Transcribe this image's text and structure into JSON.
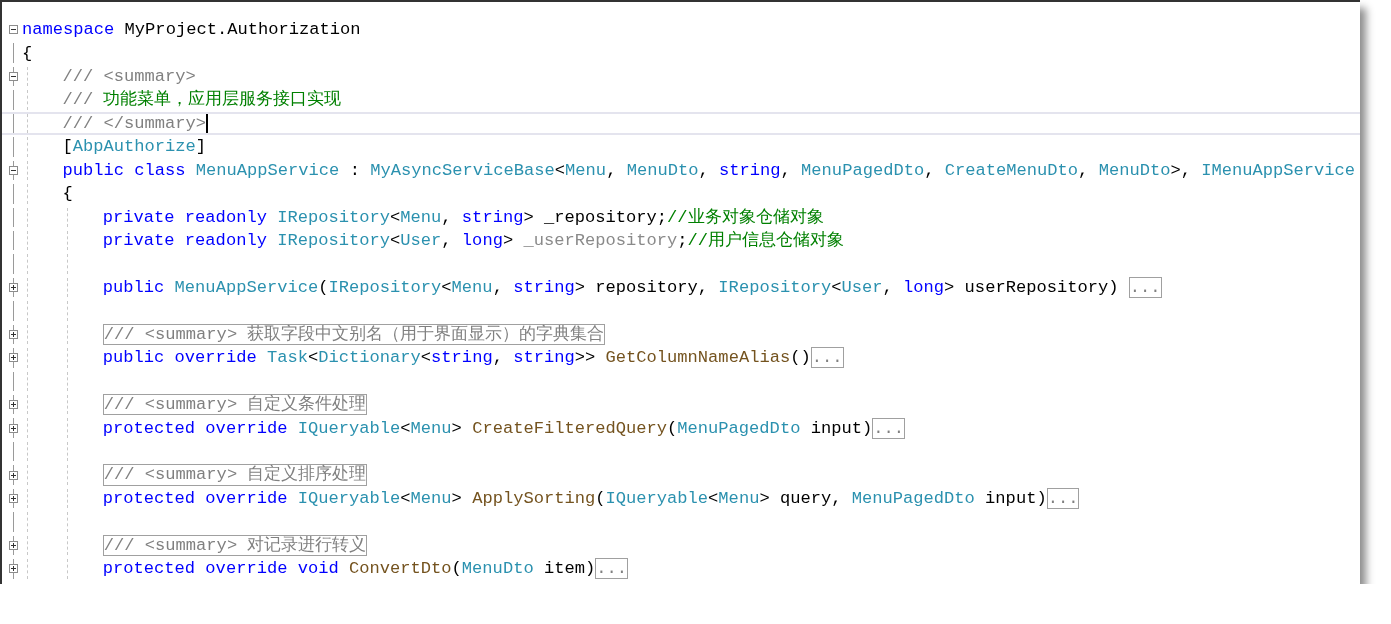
{
  "editor": {
    "lines": [
      {
        "expanded": true,
        "current": false,
        "tokens": [
          {
            "kind": "kw",
            "t": "namespace "
          },
          {
            "kind": "plain",
            "t": "MyProject.Authorization"
          }
        ]
      },
      {
        "current": false,
        "tokens": [
          {
            "kind": "plain",
            "t": "{"
          }
        ],
        "children": [
          {
            "expanded": true,
            "current": false,
            "tokens": [
              {
                "kind": "doc",
                "t": "/// <summary>"
              }
            ]
          },
          {
            "current": false,
            "tokens": [
              {
                "kind": "doc",
                "t": "/// "
              },
              {
                "kind": "comment",
                "t": "功能菜单，应用层服务接口实现"
              }
            ]
          },
          {
            "current": true,
            "tokens": [
              {
                "kind": "doc",
                "t": "/// </summary>"
              }
            ]
          },
          {
            "current": false,
            "tokens": [
              {
                "kind": "plain",
                "t": "["
              },
              {
                "kind": "type",
                "t": "AbpAuthorize"
              },
              {
                "kind": "plain",
                "t": "]"
              }
            ]
          },
          {
            "expanded": true,
            "current": false,
            "tokens": [
              {
                "kind": "kw",
                "t": "public class "
              },
              {
                "kind": "type",
                "t": "MenuAppService"
              },
              {
                "kind": "plain",
                "t": " : "
              },
              {
                "kind": "type",
                "t": "MyAsyncServiceBase"
              },
              {
                "kind": "plain",
                "t": "<"
              },
              {
                "kind": "type",
                "t": "Menu"
              },
              {
                "kind": "plain",
                "t": ", "
              },
              {
                "kind": "type",
                "t": "MenuDto"
              },
              {
                "kind": "plain",
                "t": ", "
              },
              {
                "kind": "kw",
                "t": "string"
              },
              {
                "kind": "plain",
                "t": ", "
              },
              {
                "kind": "type",
                "t": "MenuPagedDto"
              },
              {
                "kind": "plain",
                "t": ", "
              },
              {
                "kind": "type",
                "t": "CreateMenuDto"
              },
              {
                "kind": "plain",
                "t": ", "
              },
              {
                "kind": "type",
                "t": "MenuDto"
              },
              {
                "kind": "plain",
                "t": ">, "
              },
              {
                "kind": "type",
                "t": "IMenuAppService"
              }
            ]
          },
          {
            "current": false,
            "tokens": [
              {
                "kind": "plain",
                "t": "{"
              }
            ],
            "children": [
              {
                "current": false,
                "tokens": [
                  {
                    "kind": "kw",
                    "t": "private readonly "
                  },
                  {
                    "kind": "type",
                    "t": "IRepository"
                  },
                  {
                    "kind": "plain",
                    "t": "<"
                  },
                  {
                    "kind": "type",
                    "t": "Menu"
                  },
                  {
                    "kind": "plain",
                    "t": ", "
                  },
                  {
                    "kind": "kw",
                    "t": "string"
                  },
                  {
                    "kind": "plain",
                    "t": "> _repository;"
                  },
                  {
                    "kind": "comment",
                    "t": "//业务对象仓储对象"
                  }
                ]
              },
              {
                "current": false,
                "tokens": [
                  {
                    "kind": "kw",
                    "t": "private readonly "
                  },
                  {
                    "kind": "type",
                    "t": "IRepository"
                  },
                  {
                    "kind": "plain",
                    "t": "<"
                  },
                  {
                    "kind": "type",
                    "t": "User"
                  },
                  {
                    "kind": "plain",
                    "t": ", "
                  },
                  {
                    "kind": "kw",
                    "t": "long"
                  },
                  {
                    "kind": "plain",
                    "t": "> "
                  },
                  {
                    "kind": "unused",
                    "t": "_userRepository"
                  },
                  {
                    "kind": "plain",
                    "t": ";"
                  },
                  {
                    "kind": "comment",
                    "t": "//用户信息仓储对象"
                  }
                ]
              },
              {
                "current": false
              },
              {
                "expanded": false,
                "current": false,
                "tokens": [
                  {
                    "kind": "kw",
                    "t": "public "
                  },
                  {
                    "kind": "type",
                    "t": "MenuAppService"
                  },
                  {
                    "kind": "plain",
                    "t": "("
                  },
                  {
                    "kind": "type",
                    "t": "IRepository"
                  },
                  {
                    "kind": "plain",
                    "t": "<"
                  },
                  {
                    "kind": "type",
                    "t": "Menu"
                  },
                  {
                    "kind": "plain",
                    "t": ", "
                  },
                  {
                    "kind": "kw",
                    "t": "string"
                  },
                  {
                    "kind": "plain",
                    "t": "> repository, "
                  },
                  {
                    "kind": "type",
                    "t": "IRepository"
                  },
                  {
                    "kind": "plain",
                    "t": "<"
                  },
                  {
                    "kind": "type",
                    "t": "User"
                  },
                  {
                    "kind": "plain",
                    "t": ", "
                  },
                  {
                    "kind": "kw",
                    "t": "long"
                  },
                  {
                    "kind": "plain",
                    "t": "> userRepository) "
                  },
                  {
                    "kind": "folded",
                    "t": "..."
                  }
                ]
              },
              {
                "current": false
              },
              {
                "expanded": false,
                "current": false,
                "tokens": [
                  {
                    "kind": "folded",
                    "t": "/// <summary> 获取字段中文别名（用于界面显示）的字典集合"
                  }
                ]
              },
              {
                "expanded": false,
                "current": false,
                "tokens": [
                  {
                    "kind": "kw",
                    "t": "public override "
                  },
                  {
                    "kind": "type",
                    "t": "Task"
                  },
                  {
                    "kind": "plain",
                    "t": "<"
                  },
                  {
                    "kind": "type",
                    "t": "Dictionary"
                  },
                  {
                    "kind": "plain",
                    "t": "<"
                  },
                  {
                    "kind": "kw",
                    "t": "string"
                  },
                  {
                    "kind": "plain",
                    "t": ", "
                  },
                  {
                    "kind": "kw",
                    "t": "string"
                  },
                  {
                    "kind": "plain",
                    "t": ">> "
                  },
                  {
                    "kind": "method",
                    "t": "GetColumnNameAlias"
                  },
                  {
                    "kind": "plain",
                    "t": "()"
                  },
                  {
                    "kind": "folded",
                    "t": "..."
                  }
                ]
              },
              {
                "current": false
              },
              {
                "expanded": false,
                "current": false,
                "tokens": [
                  {
                    "kind": "folded",
                    "t": "/// <summary> 自定义条件处理"
                  }
                ]
              },
              {
                "expanded": false,
                "current": false,
                "tokens": [
                  {
                    "kind": "kw",
                    "t": "protected override "
                  },
                  {
                    "kind": "type",
                    "t": "IQueryable"
                  },
                  {
                    "kind": "plain",
                    "t": "<"
                  },
                  {
                    "kind": "type",
                    "t": "Menu"
                  },
                  {
                    "kind": "plain",
                    "t": "> "
                  },
                  {
                    "kind": "method",
                    "t": "CreateFilteredQuery"
                  },
                  {
                    "kind": "plain",
                    "t": "("
                  },
                  {
                    "kind": "type",
                    "t": "MenuPagedDto"
                  },
                  {
                    "kind": "plain",
                    "t": " input)"
                  },
                  {
                    "kind": "folded",
                    "t": "..."
                  }
                ]
              },
              {
                "current": false
              },
              {
                "expanded": false,
                "current": false,
                "tokens": [
                  {
                    "kind": "folded",
                    "t": "/// <summary> 自定义排序处理"
                  }
                ]
              },
              {
                "expanded": false,
                "current": false,
                "tokens": [
                  {
                    "kind": "kw",
                    "t": "protected override "
                  },
                  {
                    "kind": "type",
                    "t": "IQueryable"
                  },
                  {
                    "kind": "plain",
                    "t": "<"
                  },
                  {
                    "kind": "type",
                    "t": "Menu"
                  },
                  {
                    "kind": "plain",
                    "t": "> "
                  },
                  {
                    "kind": "method",
                    "t": "ApplySorting"
                  },
                  {
                    "kind": "plain",
                    "t": "("
                  },
                  {
                    "kind": "type",
                    "t": "IQueryable"
                  },
                  {
                    "kind": "plain",
                    "t": "<"
                  },
                  {
                    "kind": "type",
                    "t": "Menu"
                  },
                  {
                    "kind": "plain",
                    "t": "> query, "
                  },
                  {
                    "kind": "type",
                    "t": "MenuPagedDto"
                  },
                  {
                    "kind": "plain",
                    "t": " input)"
                  },
                  {
                    "kind": "folded",
                    "t": "..."
                  }
                ]
              },
              {
                "current": false
              },
              {
                "expanded": false,
                "current": false,
                "tokens": [
                  {
                    "kind": "folded",
                    "t": "/// <summary> 对记录进行转义"
                  }
                ]
              },
              {
                "expanded": false,
                "current": false,
                "tokens": [
                  {
                    "kind": "kw",
                    "t": "protected override void "
                  },
                  {
                    "kind": "method",
                    "t": "ConvertDto"
                  },
                  {
                    "kind": "plain",
                    "t": "("
                  },
                  {
                    "kind": "type",
                    "t": "MenuDto"
                  },
                  {
                    "kind": "plain",
                    "t": " item)"
                  },
                  {
                    "kind": "folded",
                    "t": "..."
                  }
                ]
              }
            ]
          }
        ]
      }
    ]
  }
}
